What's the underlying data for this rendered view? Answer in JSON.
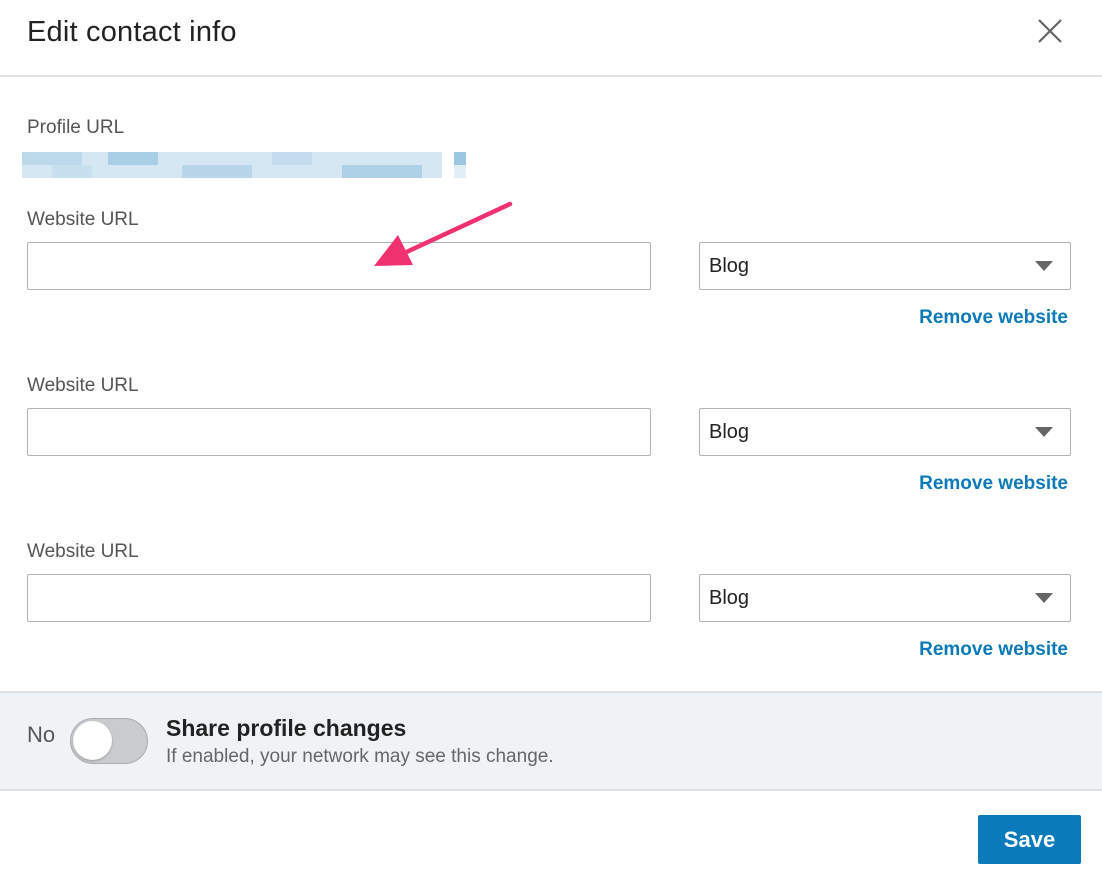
{
  "dialog": {
    "title": "Edit contact info"
  },
  "profile": {
    "label": "Profile URL"
  },
  "websites": [
    {
      "label": "Website URL",
      "value": "",
      "type": "Blog",
      "remove_label": "Remove website"
    },
    {
      "label": "Website URL",
      "value": "",
      "type": "Blog",
      "remove_label": "Remove website"
    },
    {
      "label": "Website URL",
      "value": "",
      "type": "Blog",
      "remove_label": "Remove website"
    }
  ],
  "share": {
    "state_label": "No",
    "title": "Share profile changes",
    "subtitle": "If enabled, your network may see this change."
  },
  "footer": {
    "save_label": "Save"
  },
  "colors": {
    "accent": "#0a7aba",
    "annotation": "#f0326e"
  },
  "icons": {
    "close": "close-icon",
    "caret": "chevron-down-icon"
  }
}
